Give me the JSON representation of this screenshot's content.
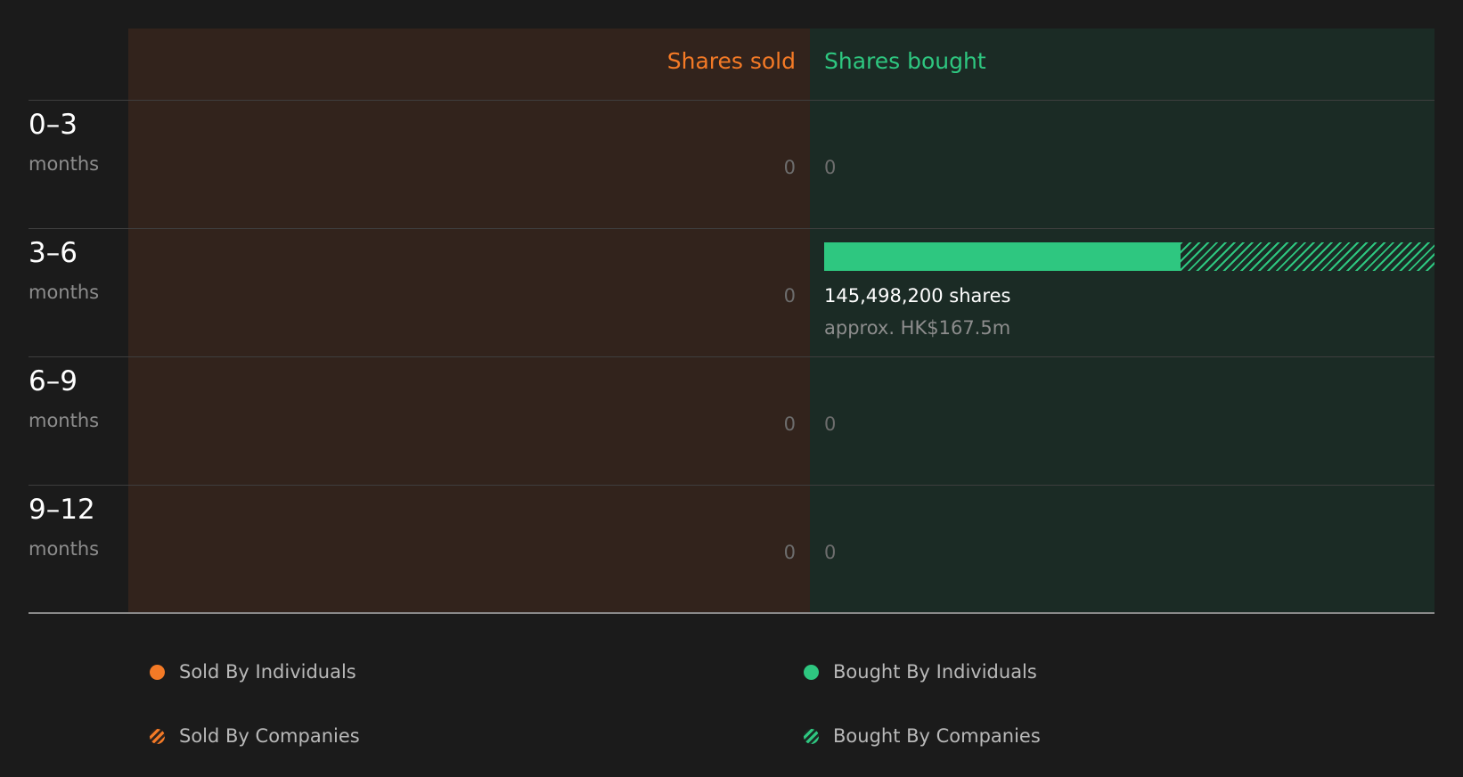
{
  "colors": {
    "sold": "#f47a26",
    "bought": "#2ec780"
  },
  "chart_data": {
    "type": "bar",
    "header_sold": "Shares sold",
    "header_bought": "Shares bought",
    "categories": [
      {
        "range": "0–3",
        "unit": "months"
      },
      {
        "range": "3–6",
        "unit": "months"
      },
      {
        "range": "6–9",
        "unit": "months"
      },
      {
        "range": "9–12",
        "unit": "months"
      }
    ],
    "series": [
      {
        "name": "Sold By Individuals",
        "values": [
          0,
          0,
          0,
          0
        ]
      },
      {
        "name": "Sold By Companies",
        "values": [
          0,
          0,
          0,
          0
        ]
      },
      {
        "name": "Bought By Individuals",
        "values": [
          0,
          85000000,
          0,
          0
        ]
      },
      {
        "name": "Bought By Companies",
        "values": [
          0,
          60498200,
          0,
          0
        ]
      }
    ],
    "sold_labels": [
      "0",
      "0",
      "0",
      "0"
    ],
    "bought_labels": [
      {
        "shares": "0",
        "approx": ""
      },
      {
        "shares": "145,498,200 shares",
        "approx": "approx. HK$167.5m"
      },
      {
        "shares": "0",
        "approx": ""
      },
      {
        "shares": "0",
        "approx": ""
      }
    ],
    "bought_max": 145498200,
    "legend": [
      {
        "label": "Sold By Individuals",
        "style": "solid",
        "color": "#f47a26"
      },
      {
        "label": "Bought By Individuals",
        "style": "solid",
        "color": "#2ec780"
      },
      {
        "label": "Sold By Companies",
        "style": "hatched",
        "color": "#f47a26"
      },
      {
        "label": "Bought By Companies",
        "style": "hatched",
        "color": "#2ec780"
      }
    ]
  }
}
